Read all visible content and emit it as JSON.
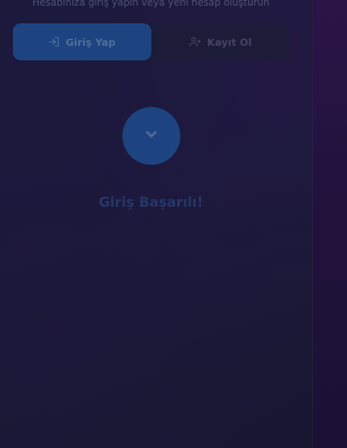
{
  "header": {
    "subtitle": "Hesabınıza giriş yapın veya yeni hesap oluşturun"
  },
  "tabs": [
    {
      "label": "Giriş Yap",
      "icon": "login-icon",
      "active": true
    },
    {
      "label": "Kayıt Ol",
      "icon": "user-plus-icon",
      "active": false
    }
  ],
  "status": {
    "icon": "chevron-down-icon",
    "message": "Giriş Başarılı!"
  },
  "colors": {
    "accent": "#1d4480",
    "background": "#18163a",
    "side_strip": "#2b1547"
  }
}
